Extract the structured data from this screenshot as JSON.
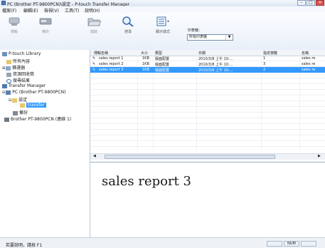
{
  "window": {
    "title": "PC (Brother PT-9800PCN)\\設定 - P-touch Transfer Manager",
    "controls": [
      "–",
      "□",
      "✕"
    ]
  },
  "menu": [
    "檔案(F)",
    "編輯(E)",
    "檢視(V)",
    "工具(T)",
    "說明(H)"
  ],
  "toolbar": {
    "buttons": [
      {
        "label": "傳輸",
        "icon": "transfer-icon"
      },
      {
        "label": "備份",
        "icon": "backup-icon"
      },
      {
        "label": "開啟",
        "icon": "open-icon"
      },
      {
        "label": "搜尋",
        "icon": "search-icon"
      },
      {
        "label": "顯示樣式",
        "icon": "view-style-icon"
      }
    ],
    "printer_label": "印表機：",
    "printer_value": "所有印表機"
  },
  "tree": {
    "items": [
      {
        "label": "P-touch Library",
        "icon": "library-icon"
      },
      {
        "label": "所有內容",
        "icon": "folder-icon"
      },
      {
        "label": "篩選器",
        "icon": "filter-icon"
      },
      {
        "label": "資源回收筒",
        "icon": "recycle-icon"
      },
      {
        "label": "搜尋結果",
        "icon": "search-results-icon"
      },
      {
        "label": "Transfer Manager",
        "icon": "transfer-manager-icon"
      },
      {
        "label": "PC (Brother PT-9800PCN)",
        "icon": "pc-icon"
      },
      {
        "label": "設定",
        "icon": "settings-folder-icon"
      },
      {
        "label": "transfer",
        "icon": "folder-icon",
        "selected": true
      },
      {
        "label": "備份",
        "icon": "backup-icon"
      },
      {
        "label": "Brother PT-9800PCN (連線 1)",
        "icon": "printer-icon"
      }
    ]
  },
  "list": {
    "columns": [
      "傳輸名稱",
      "大小",
      "類型",
      "日期",
      "指定按鍵",
      "名稱"
    ],
    "rows": [
      {
        "name": "sales report 1",
        "size": "1KB",
        "type": "版面配置",
        "date": "2010/3/8 上午 10:...",
        "key": "1",
        "title": "sales re"
      },
      {
        "name": "sales report 2",
        "size": "1KB",
        "type": "版面配置",
        "date": "2010/3/8 上午 10:...",
        "key": "3",
        "title": "sales re"
      },
      {
        "name": "sales report 3",
        "size": "1KB",
        "type": "版面配置",
        "date": "2010/3/8 上午 10:...",
        "key": "2",
        "title": "sales re",
        "selected": true
      }
    ]
  },
  "preview": {
    "text": "sales report 3"
  },
  "status": {
    "text": "若要說明，請按 F1",
    "num": "NUM"
  },
  "colors": {
    "selection": "#3399ff",
    "toolbar_top": "#fbfdff",
    "toolbar_bottom": "#e9f0f9"
  }
}
